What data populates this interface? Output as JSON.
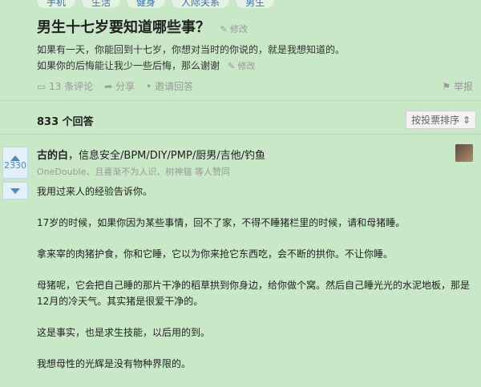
{
  "topics": [
    "手机",
    "生活",
    "健身",
    "人际关系",
    "男生"
  ],
  "question": {
    "title": "男生十七岁要知道哪些事？",
    "edit_label": "修改",
    "detail_lines": [
      "如果有一天，你能回到十七岁，你想对当时的你说的，就是我想知道的。",
      "如果你的后悔能让我少一些后悔，那么谢谢"
    ],
    "comments": "13 条评论",
    "share": "分享",
    "invite": "邀请回答",
    "report": "举报"
  },
  "answers_header": {
    "count": "833 个回答",
    "sort": "按投票排序"
  },
  "answer": {
    "votes": "2330",
    "author": "古的白",
    "bio": "信息安全/BPM/DIY/PMP/厨男/吉他/钓鱼",
    "voters": "OneDouble、且喜渐不为人识、树神猫 等人赞同",
    "paragraphs": [
      "我用过来人的经验告诉你。",
      "17岁的时候，如果你因为某些事情，回不了家，不得不睡猪栏里的时候，请和母猪睡。",
      "拿来宰的肉猪护食，你和它睡，它以为你来抢它东西吃，会不断的拱你。不让你睡。",
      "母猪呢，它会把自己睡的那片干净的稻草拱到你身边，给你做个窝。然后自己睡光光的水泥地板，那是12月的冷天气。其实猪是很爱干净的。",
      "这是事实，也是求生技能，以后用的到。",
      "我想母性的光辉是没有物种界限的。"
    ]
  }
}
